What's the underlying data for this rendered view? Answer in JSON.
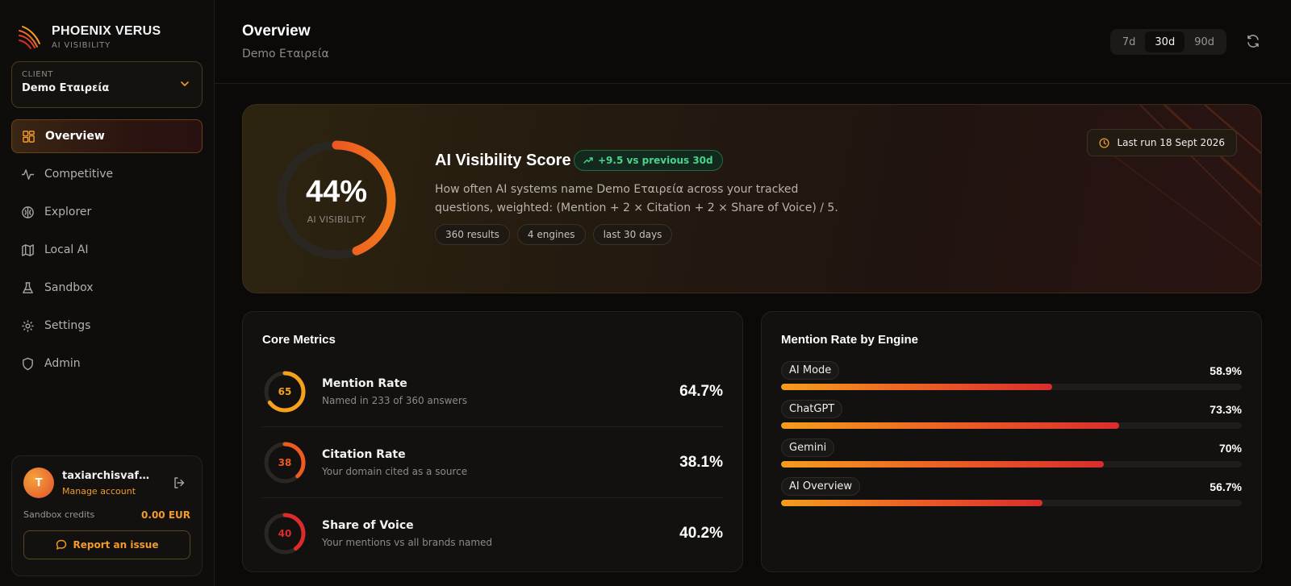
{
  "brand": {
    "name": "PHOENIX VERUS",
    "subtitle": "AI VISIBILITY"
  },
  "client": {
    "label": "CLIENT",
    "name": "Demo Εταιρεία"
  },
  "nav": [
    {
      "label": "Overview",
      "icon": "dashboard-icon",
      "active": true
    },
    {
      "label": "Competitive",
      "icon": "activity-icon"
    },
    {
      "label": "Explorer",
      "icon": "brain-icon"
    },
    {
      "label": "Local AI",
      "icon": "map-icon"
    },
    {
      "label": "Sandbox",
      "icon": "flask-icon"
    },
    {
      "label": "Settings",
      "icon": "gear-icon"
    },
    {
      "label": "Admin",
      "icon": "shield-icon"
    }
  ],
  "account": {
    "initial": "T",
    "name": "taxiarchisvafeas...",
    "manage": "Manage account",
    "credits_label": "Sandbox credits",
    "credits_value": "0.00 EUR",
    "report": "Report an issue"
  },
  "header": {
    "title": "Overview",
    "subtitle": "Demo Εταιρεία",
    "ranges": [
      "7d",
      "30d",
      "90d"
    ],
    "active_range": "30d"
  },
  "hero": {
    "score": 44,
    "score_text": "44%",
    "score_label": "AI VISIBILITY",
    "title": "AI Visibility Score",
    "trend": "+9.5 vs previous 30d",
    "description": "How often AI systems name Demo Εταιρεία across your tracked questions, weighted: (Mention + 2 × Citation + 2 × Share of Voice) / 5.",
    "pills": [
      "360 results",
      "4 engines",
      "last 30 days"
    ],
    "last_run": "Last run 18 Sept 2026"
  },
  "core_metrics": {
    "title": "Core Metrics",
    "items": [
      {
        "ring": 65,
        "ring_text": "65",
        "color": "#f5a11c",
        "name": "Mention Rate",
        "sub": "Named in 233 of 360 answers",
        "value": "64.7%"
      },
      {
        "ring": 38,
        "ring_text": "38",
        "color": "#ee5a20",
        "name": "Citation Rate",
        "sub": "Your domain cited as a source",
        "value": "38.1%"
      },
      {
        "ring": 40,
        "ring_text": "40",
        "color": "#dc2b2b",
        "name": "Share of Voice",
        "sub": "Your mentions vs all brands named",
        "value": "40.2%"
      }
    ]
  },
  "engines": {
    "title": "Mention Rate by Engine",
    "items": [
      {
        "name": "AI Mode",
        "value": "58.9%",
        "pct": 58.9
      },
      {
        "name": "ChatGPT",
        "value": "73.3%",
        "pct": 73.3
      },
      {
        "name": "Gemini",
        "value": "70%",
        "pct": 70
      },
      {
        "name": "AI Overview",
        "value": "56.7%",
        "pct": 56.7
      }
    ]
  },
  "colors": {
    "accent": "#f39a2b",
    "green": "#4ad38a",
    "red": "#e0322a"
  }
}
